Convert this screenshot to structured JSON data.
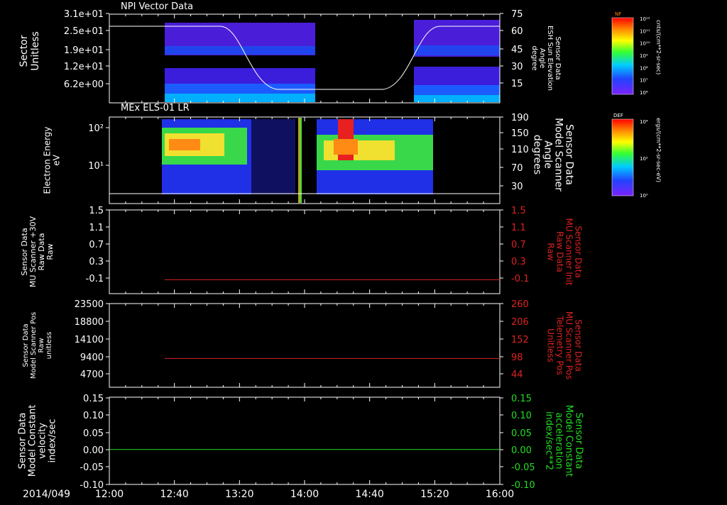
{
  "chart_data": [
    {
      "type": "heatmap",
      "title": "NPI Vector Data",
      "ylabel": "Sector",
      "ylabel_unit": "Unitless",
      "y_ticks": [
        "3.1e+01",
        "2.5e+01",
        "1.9e+01",
        "1.2e+01",
        "6.2e+00"
      ],
      "y2label_lines": [
        "Sensor Data",
        "ESH Sun Elevation",
        "Angle",
        "degree"
      ],
      "y2_ticks": [
        "75",
        "60",
        "45",
        "30",
        "15"
      ],
      "overlay": "sun-elevation-curve",
      "colorbar": {
        "label": "NF",
        "unit": "cnts/(cm**2-sr-sec)",
        "ticks": [
          "10¹²",
          "10¹¹",
          "10¹⁰",
          "10⁹",
          "10⁸",
          "10⁷",
          "10⁶"
        ]
      }
    },
    {
      "type": "heatmap",
      "title": "MEx ELS-01 LR",
      "ylabel_lines": [
        "Electron Energy",
        "eV"
      ],
      "y_ticks": [
        "10²",
        "10¹"
      ],
      "y2label_lines": [
        "Sensor Data",
        "Model Scanner",
        "Angle",
        "degrees"
      ],
      "y2_ticks": [
        "190",
        "150",
        "110",
        "70",
        "30"
      ],
      "colorbar": {
        "label": "DEF",
        "unit": "ergs/(cm**2-sr-sec-eV)",
        "ticks": [
          "10⁴",
          "10²",
          "10⁰"
        ]
      }
    },
    {
      "type": "line",
      "ylabel_lines": [
        "Sensor Data",
        "MU Scanner +30V",
        "Raw Data",
        "Raw"
      ],
      "y_ticks": [
        "1.5",
        "1.1",
        "0.7",
        "0.3",
        "-0.1"
      ],
      "ylim": [
        -0.3,
        1.5
      ],
      "y2label_lines": [
        "Sensor Data",
        "MU Scanner Init",
        "Raw Data",
        "Raw"
      ],
      "y2_ticks": [
        "1.5",
        "1.1",
        "0.7",
        "0.3",
        "-0.1"
      ],
      "series": [
        {
          "x_start": "12:34",
          "x_end": "16:00",
          "value": 0,
          "color": "#dd2222"
        }
      ]
    },
    {
      "type": "line",
      "ylabel_lines": [
        "Sensor Data",
        "Model Scanner Pos",
        "Raw",
        "unitless"
      ],
      "y_ticks": [
        "23500",
        "18800",
        "14100",
        "9400",
        "4700"
      ],
      "ylim": [
        0,
        23500
      ],
      "y2label_lines": [
        "Sensor Data",
        "MU Scanner Pos",
        "Telemetry Pos",
        "Unitless"
      ],
      "y2_ticks": [
        "260",
        "206",
        "152",
        "98",
        "44"
      ],
      "series": [
        {
          "x_start": "12:34",
          "x_end": "16:00",
          "value": 8100,
          "color": "#dd2222"
        }
      ]
    },
    {
      "type": "line",
      "ylabel_lines": [
        "Sensor Data",
        "Model Constant",
        "velocity",
        "index/sec"
      ],
      "y_ticks": [
        "0.15",
        "0.10",
        "0.05",
        "0.00",
        "-0.05",
        "-0.10"
      ],
      "ylim": [
        -0.1,
        0.15
      ],
      "y2label_lines": [
        "Sensor Data",
        "Model Constant",
        "acceleration",
        "index/sec**2"
      ],
      "y2_ticks": [
        "0.15",
        "0.10",
        "0.05",
        "0.00",
        "-0.05",
        "-0.10"
      ],
      "series": [
        {
          "x_start": "12:00",
          "x_end": "16:00",
          "value": 0.0,
          "color": "#22dd22"
        }
      ]
    }
  ],
  "time_axis": {
    "date": "2014/049",
    "ticks": [
      "12:00",
      "12:40",
      "13:20",
      "14:00",
      "14:40",
      "15:20",
      "16:00"
    ]
  },
  "colors": {
    "bg": "#000000",
    "fg": "#ffffff",
    "red": "#dd2222",
    "green": "#22dd22"
  }
}
